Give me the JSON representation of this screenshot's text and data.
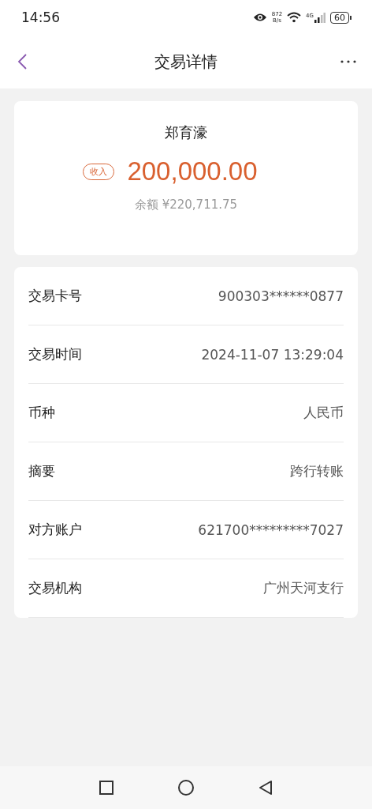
{
  "status_bar": {
    "time": "14:56",
    "net_speed_value": "872",
    "net_speed_unit": "B/s",
    "network": "4G",
    "battery": "60"
  },
  "header": {
    "title": "交易详情"
  },
  "summary": {
    "name": "郑育濠",
    "tag": "收入",
    "amount": "200,000.00",
    "balance_label": "余额",
    "balance": "¥220,711.75"
  },
  "details": [
    {
      "label": "交易卡号",
      "value": "900303******0877"
    },
    {
      "label": "交易时间",
      "value": "2024-11-07 13:29:04"
    },
    {
      "label": "币种",
      "value": "人民币"
    },
    {
      "label": "摘要",
      "value": "跨行转账"
    },
    {
      "label": "对方账户",
      "value": "621700*********7027"
    },
    {
      "label": "交易机构",
      "value": "广州天河支行"
    }
  ]
}
